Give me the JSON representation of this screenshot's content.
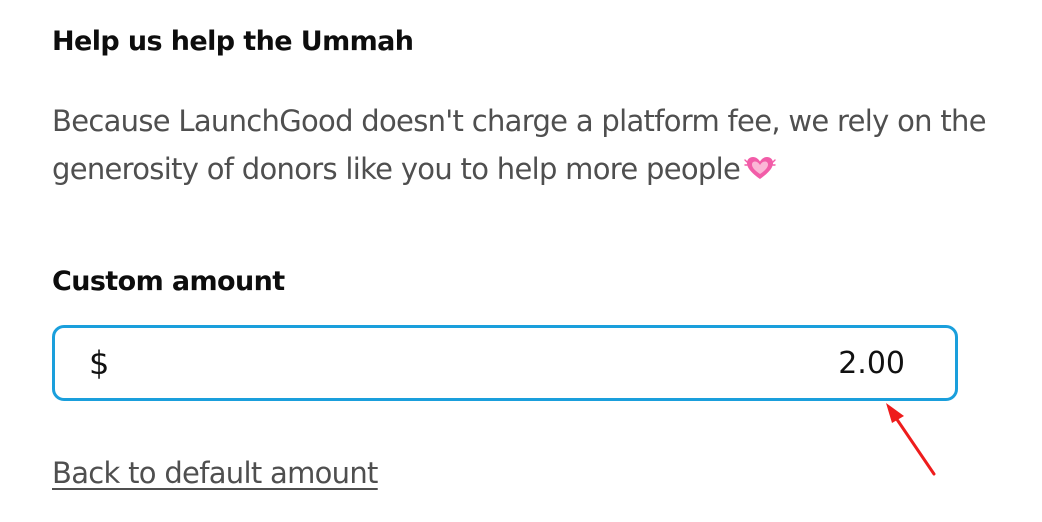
{
  "section": {
    "title": "Help us help the Ummah",
    "description": "Because LaunchGood doesn't charge a platform fee, we rely on the generosity of donors like you to help more people",
    "description_icon": "growing-heart-icon"
  },
  "custom_amount": {
    "label": "Custom amount",
    "currency_symbol": "$",
    "value": "2.00"
  },
  "back_link": {
    "label": "Back to default amount"
  },
  "annotation": {
    "icon": "red-arrow-icon",
    "color": "#ee1c1c"
  },
  "colors": {
    "input_border": "#1a9fdc",
    "heart": "#f25ca8"
  }
}
